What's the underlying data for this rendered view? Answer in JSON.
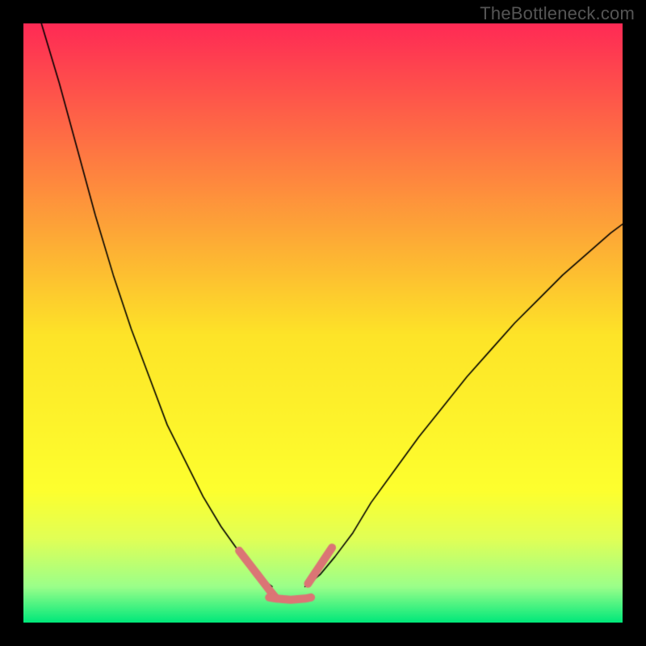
{
  "watermark": "TheBottleneck.com",
  "chart_data": {
    "type": "line",
    "title": "",
    "xlabel": "",
    "ylabel": "",
    "xlim": [
      0,
      100
    ],
    "ylim": [
      0,
      100
    ],
    "background_gradient": {
      "stops": [
        {
          "t": 0.0,
          "color": "#ff2a55"
        },
        {
          "t": 0.52,
          "color": "#fde428"
        },
        {
          "t": 0.78,
          "color": "#fdff2e"
        },
        {
          "t": 0.86,
          "color": "#e1ff56"
        },
        {
          "t": 0.94,
          "color": "#9bff8a"
        },
        {
          "t": 1.0,
          "color": "#00e87a"
        }
      ]
    },
    "series": [
      {
        "name": "left-arm",
        "color": "#000000",
        "width": 1.6,
        "x": [
          3,
          6,
          9,
          12,
          15,
          18,
          21,
          24,
          27,
          30,
          33,
          35.5,
          37.5,
          39.5,
          41.5
        ],
        "y": [
          100,
          90,
          79,
          68,
          58,
          49,
          41,
          33,
          27,
          21,
          16,
          12.5,
          10,
          7.5,
          6
        ]
      },
      {
        "name": "right-arm",
        "color": "#000000",
        "width": 1.6,
        "x": [
          47,
          49.5,
          52,
          55,
          58,
          62,
          66,
          70,
          74,
          78,
          82,
          86,
          90,
          94,
          98,
          100
        ],
        "y": [
          6,
          8,
          11,
          15,
          20,
          25.5,
          31,
          36,
          41,
          45.5,
          50,
          54,
          58,
          61.5,
          65,
          66.5
        ]
      },
      {
        "name": "left-marker-strip",
        "color": "#db7575",
        "width": 10,
        "x": [
          36,
          37.0,
          38.0,
          39.0,
          40.0,
          41.0,
          42.0
        ],
        "y": [
          12.0,
          10.7,
          9.4,
          8.1,
          6.8,
          5.5,
          4.3
        ]
      },
      {
        "name": "right-marker-strip",
        "color": "#db7575",
        "width": 10,
        "x": [
          47.5,
          48.5,
          49.5,
          50.5,
          51.5
        ],
        "y": [
          6.5,
          8.0,
          9.5,
          11.0,
          12.5
        ]
      },
      {
        "name": "valley-floor",
        "color": "#db7575",
        "width": 10,
        "x": [
          41.0,
          42.2,
          43.4,
          44.6,
          45.8,
          47.0,
          48.0
        ],
        "y": [
          4.2,
          4.0,
          3.9,
          3.8,
          3.9,
          4.0,
          4.2
        ]
      }
    ]
  }
}
